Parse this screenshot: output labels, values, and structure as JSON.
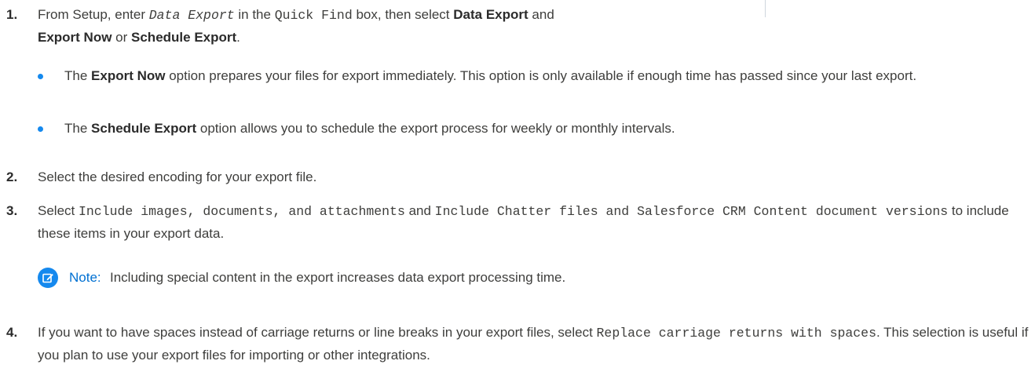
{
  "steps": [
    {
      "number": "1.",
      "line1": {
        "t1": "From Setup, enter ",
        "code1": "Data Export",
        "t2": " in the ",
        "code2": "Quick Find",
        "t3": " box, then select ",
        "b1": "Data Export",
        "t4": " and"
      },
      "line2": {
        "b1": "Export Now",
        "t1": " or ",
        "b2": "Schedule Export",
        "t2": "."
      },
      "bullets": [
        {
          "t1": "The ",
          "b1": "Export Now",
          "t2": " option prepares your files for export immediately. This option is only available if enough time has passed since your last export."
        },
        {
          "t1": "The ",
          "b1": "Schedule Export",
          "t2": " option allows you to schedule the export process for weekly or monthly intervals."
        }
      ]
    },
    {
      "number": "2.",
      "text": "Select the desired encoding for your export file."
    },
    {
      "number": "3.",
      "t1": "Select ",
      "code1": "Include images, documents, and attachments",
      "t2": " and ",
      "code2": "Include Chatter files and Salesforce CRM Content document versions",
      "t3": " to include these items in your export data.",
      "note": {
        "label": "Note:",
        "text": "Including special content in the export increases data export processing time."
      }
    },
    {
      "number": "4.",
      "t1": "If you want to have spaces instead of carriage returns or line breaks in your export files, select ",
      "code1": "Replace carriage returns with spaces",
      "t2": ". This selection is useful if you plan to use your export files for importing or other integrations."
    }
  ],
  "icons": {
    "note": "edit-note-icon",
    "bullet": "bullet-dot"
  },
  "colors": {
    "accent": "#1589ee",
    "note_label": "#0070d2",
    "text": "#3e3e3c"
  }
}
